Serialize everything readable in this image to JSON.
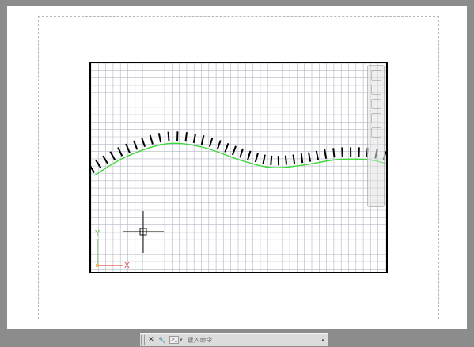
{
  "cad": {
    "ucs_x_label": "X",
    "ucs_y_label": "Y",
    "colors": {
      "grid_minor": "#b3b7c6",
      "frame": "#000000",
      "curve": "#3fd83a",
      "ticks": "#000000",
      "ucs_x": "#e05050",
      "ucs_y": "#63b845",
      "crosshair": "#000000"
    },
    "icons": {
      "close": "close-icon",
      "customize": "wrench-icon",
      "prompt": "command-prompt-icon",
      "history": "chevron-up-icon"
    }
  },
  "cmdline": {
    "close_glyph": "✕",
    "customize_glyph": "🔧",
    "prompt_glyph": ">_",
    "prompt_caret": "▾",
    "placeholder": "鍵入命令",
    "history_glyph": "▴"
  }
}
